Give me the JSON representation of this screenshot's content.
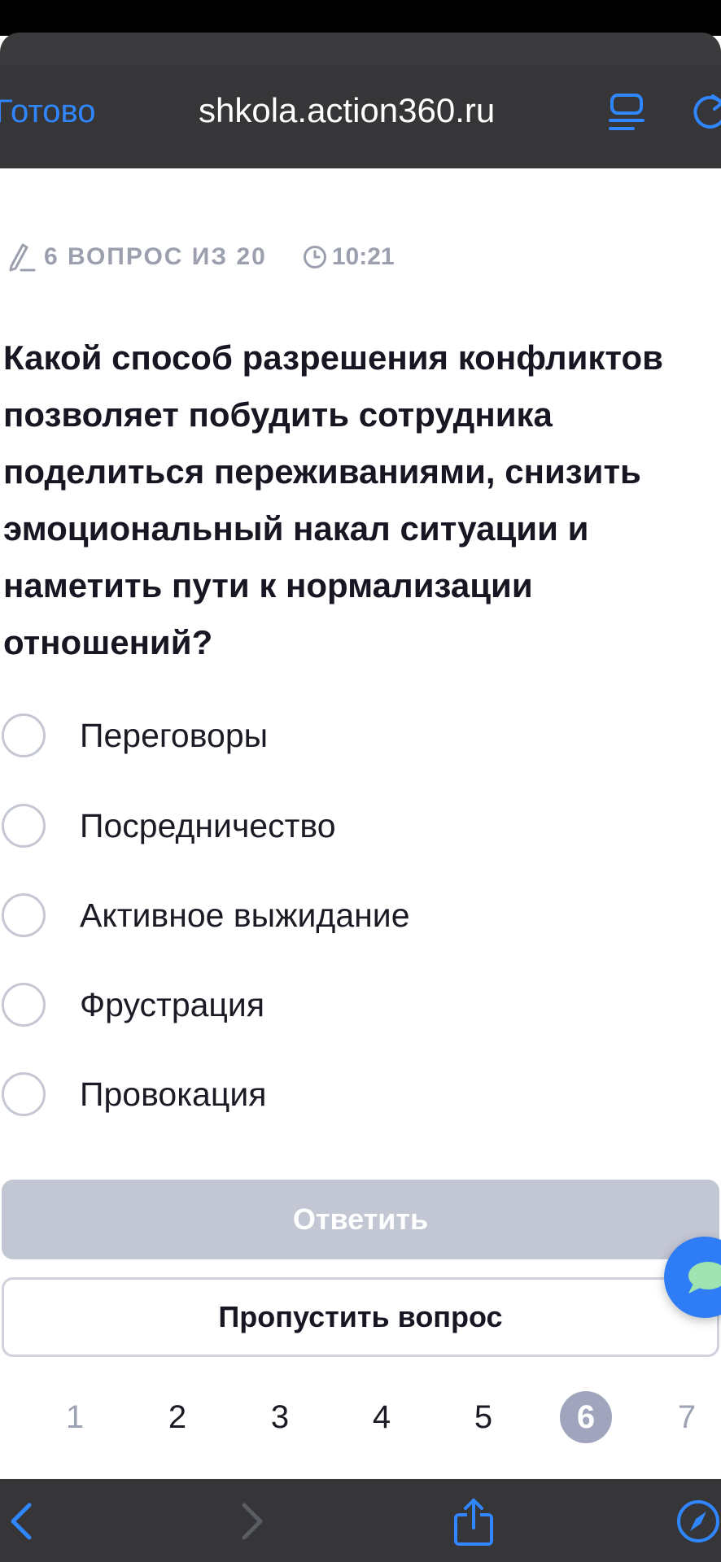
{
  "browser": {
    "done_label": "Готово",
    "url": "shkola.action360.ru",
    "accent": "#2f86ff"
  },
  "quiz": {
    "counter": "6 ВОПРОС ИЗ 20",
    "timer": "10:21",
    "question": "Какой способ разрешения конфликтов позволяет побудить сотрудника поделиться переживаниями, снизить эмоциональный накал ситуации и наметить пути к нормализации отношений?",
    "options": [
      {
        "label": "Переговоры"
      },
      {
        "label": "Посредничество"
      },
      {
        "label": "Активное выжидание"
      },
      {
        "label": "Фрустрация"
      },
      {
        "label": "Провокация"
      }
    ],
    "answer_label": "Ответить",
    "skip_label": "Пропустить вопрос"
  },
  "pager": {
    "pages": [
      "1",
      "2",
      "3",
      "4",
      "5",
      "6",
      "7"
    ],
    "current": "6"
  },
  "icons": {
    "reader": "reader-icon",
    "reload": "reload-icon",
    "pencil": "pencil-icon",
    "clock": "clock-icon",
    "chat": "chat-icon",
    "back": "back-icon",
    "forward": "forward-icon",
    "share": "share-icon",
    "compass": "compass-icon"
  }
}
